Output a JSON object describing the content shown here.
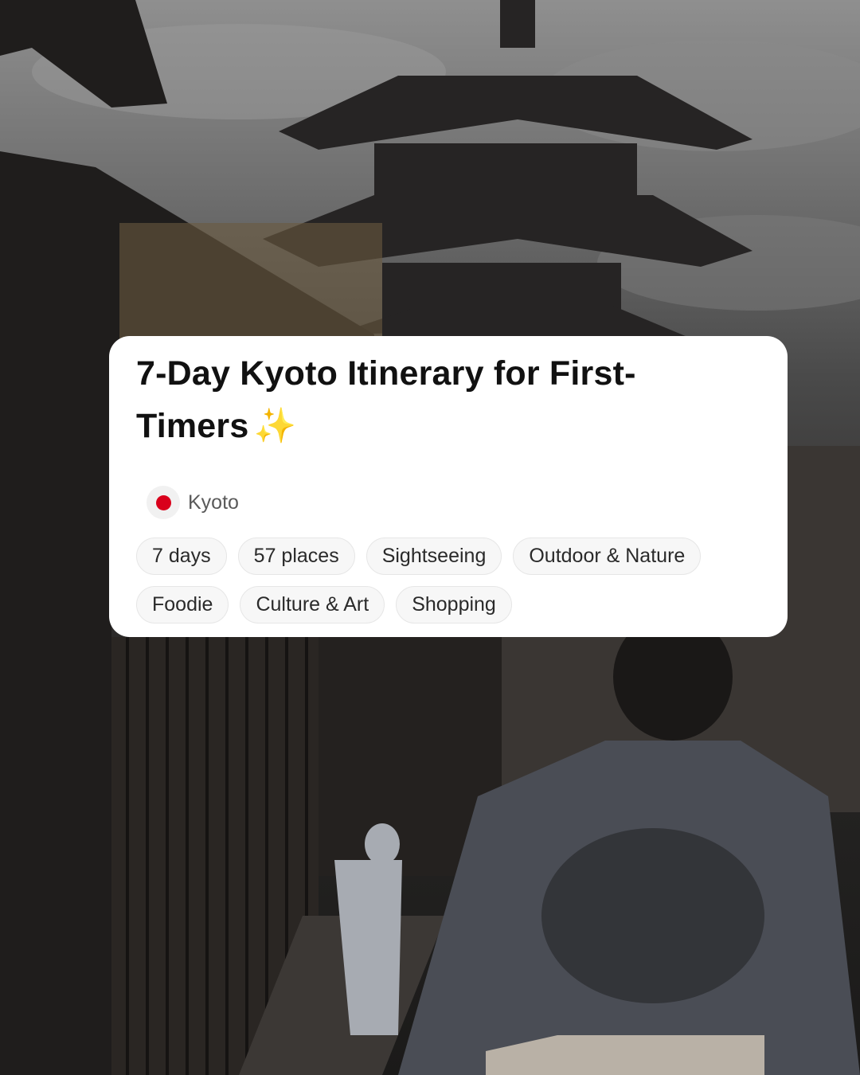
{
  "card": {
    "title": "7-Day Kyoto Itinerary for First-Timers",
    "title_emoji": "✨",
    "location": {
      "flag_icon": "japan-flag-icon",
      "name": "Kyoto"
    },
    "tags": [
      "7 days",
      "57 places",
      "Sightseeing",
      "Outdoor & Nature",
      "Foodie",
      "Culture & Art",
      "Shopping"
    ]
  },
  "colors": {
    "card_background": "#ffffff",
    "title_text": "#111111",
    "flag_red": "#d9001b",
    "tag_background": "#f7f7f7",
    "tag_border": "#e6e6e6"
  }
}
